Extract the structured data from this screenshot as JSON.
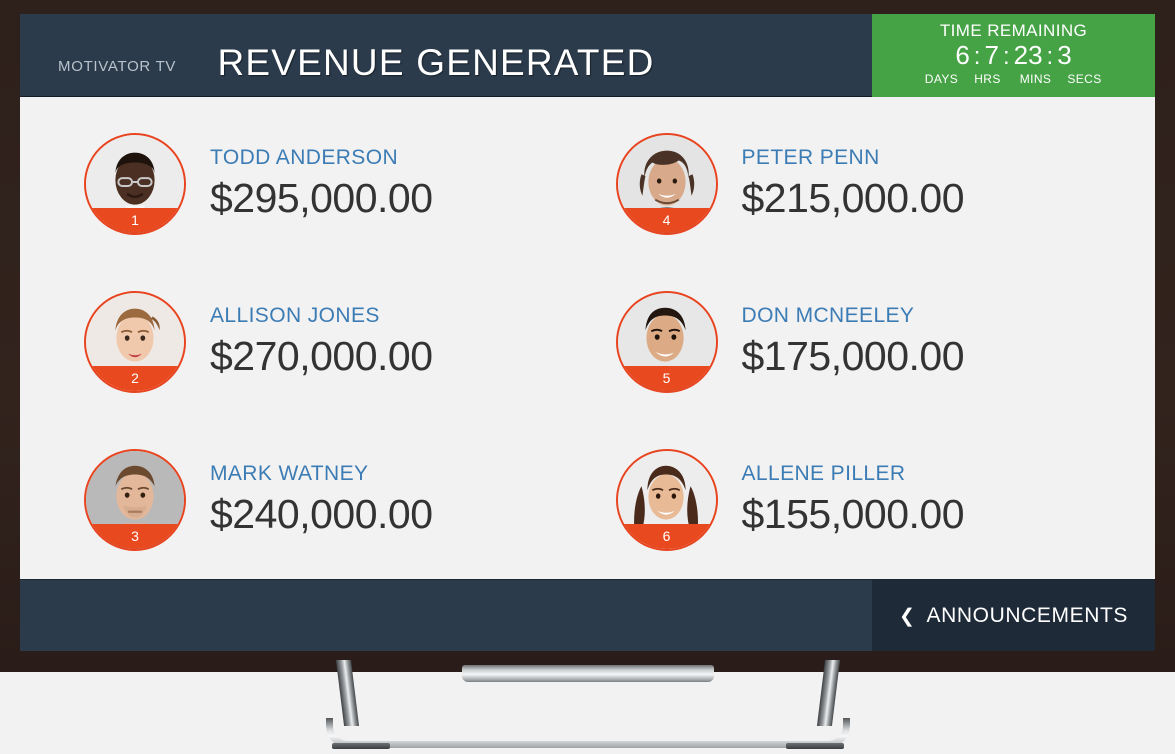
{
  "header": {
    "brand": "MOTIVATOR TV",
    "title": "REVENUE GENERATED"
  },
  "timer": {
    "heading": "TIME REMAINING",
    "days": "6",
    "hours": "7",
    "minutes": "23",
    "seconds": "3",
    "separator": ":",
    "label_days": "DAYS",
    "label_hours": "HRS",
    "label_minutes": "MINS",
    "label_seconds": "SECS"
  },
  "leaderboard": [
    {
      "rank": "1",
      "name": "TODD ANDERSON",
      "amount": "$295,000.00",
      "avatar": "avatar-photo-todd-anderson"
    },
    {
      "rank": "4",
      "name": "PETER PENN",
      "amount": "$215,000.00",
      "avatar": "avatar-photo-peter-penn"
    },
    {
      "rank": "2",
      "name": "ALLISON JONES",
      "amount": "$270,000.00",
      "avatar": "avatar-photo-allison-jones"
    },
    {
      "rank": "5",
      "name": "DON MCNEELEY",
      "amount": "$175,000.00",
      "avatar": "avatar-photo-don-mcneeley"
    },
    {
      "rank": "3",
      "name": "MARK WATNEY",
      "amount": "$240,000.00",
      "avatar": "avatar-photo-mark-watney"
    },
    {
      "rank": "6",
      "name": "ALLENE PILLER",
      "amount": "$155,000.00",
      "avatar": "avatar-photo-allene-piller"
    }
  ],
  "footer": {
    "announcements_label": "ANNOUNCEMENTS",
    "chevron_glyph": "❮"
  },
  "colors": {
    "header_bar": "#2b3b4b",
    "timer_green": "#45a345",
    "accent_orange": "#e8441f",
    "name_blue": "#3c7cb5",
    "amount_dark": "#333333",
    "screen_bg": "#f2f2f2",
    "bezel": "#2e201b",
    "announcements_bg": "#1e2a38"
  }
}
